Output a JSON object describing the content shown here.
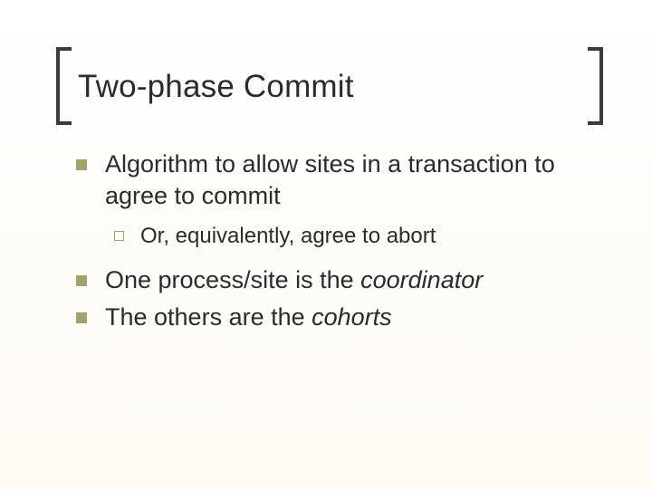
{
  "title": "Two-phase Commit",
  "bullets": {
    "b1": "Algorithm to allow sites in a transaction to agree to commit",
    "b1_sub": "Or, equivalently, agree to abort",
    "b2_pre": "One process/site is the ",
    "b2_em": "coordinator",
    "b3_pre": "The others are the ",
    "b3_em": "cohorts"
  }
}
